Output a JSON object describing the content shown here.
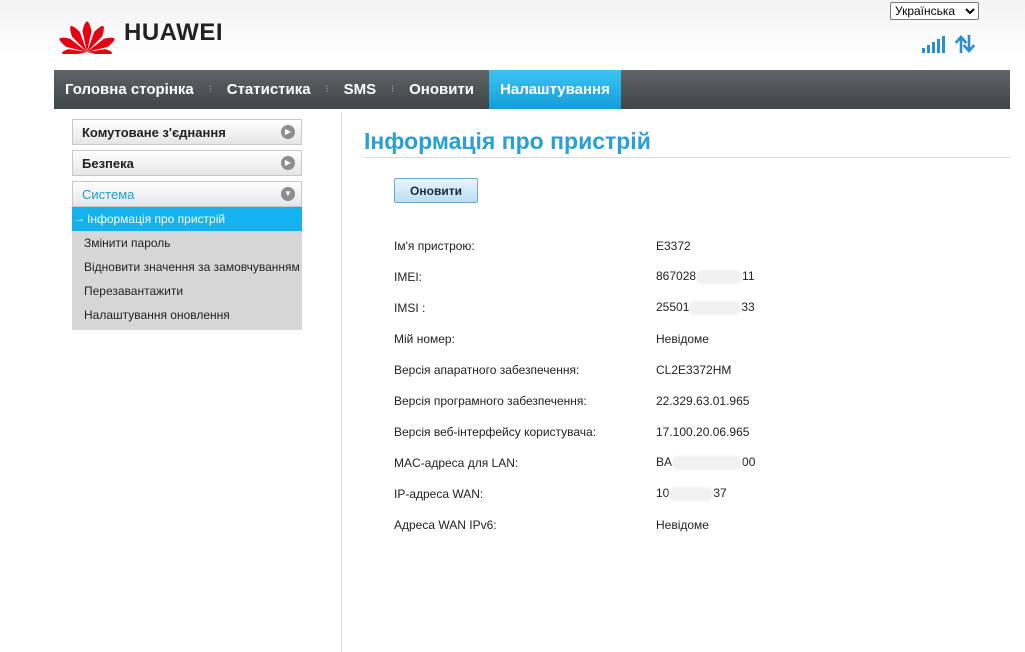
{
  "header": {
    "brand": "HUAWEI",
    "language": {
      "selected": "Українська",
      "options": [
        "Українська"
      ]
    },
    "colors": {
      "logo_red": "#e60012",
      "accent": "#2a9fd4",
      "nav_active": "#1fb0ea"
    }
  },
  "nav": {
    "items": [
      {
        "label": "Головна сторінка"
      },
      {
        "label": "Статистика"
      },
      {
        "label": "SMS"
      },
      {
        "label": "Оновити"
      },
      {
        "label": "Налаштування",
        "active": true
      }
    ]
  },
  "sidebar": {
    "sections": [
      {
        "label": "Комутоване з'єднання"
      },
      {
        "label": "Безпека"
      },
      {
        "label": "Система"
      }
    ],
    "system_items": [
      {
        "label": "Інформація про пристрій",
        "active": true
      },
      {
        "label": "Змінити пароль"
      },
      {
        "label": "Відновити значення за замовчуванням"
      },
      {
        "label": "Перезавантажити"
      },
      {
        "label": "Налаштування оновлення"
      }
    ]
  },
  "main": {
    "title": "Інформація про пристрій",
    "refresh_label": "Оновити",
    "rows": [
      {
        "label": "Ім'я пристрою:",
        "value": "E3372"
      },
      {
        "label": "IMEI:",
        "value_start": "867028",
        "value_end": "11"
      },
      {
        "label": "IMSI :",
        "value_start": "25501",
        "value_end": "33"
      },
      {
        "label": "Мій номер:",
        "value": "Невідоме"
      },
      {
        "label": "Версія апаратного забезпечення:",
        "value": "CL2E3372HM"
      },
      {
        "label": "Версія програмного забезпечення:",
        "value": "22.329.63.01.965"
      },
      {
        "label": "Версія веб-інтерфейсу користувача:",
        "value": "17.100.20.06.965"
      },
      {
        "label": "MAC-адреса для LAN:",
        "value_start": "BA",
        "value_end": "00"
      },
      {
        "label": "IP-адреса WAN:",
        "value_start": "10",
        "value_end": "37"
      },
      {
        "label": "Адреса WAN IPv6:",
        "value": "Невідоме"
      }
    ]
  },
  "icons": {
    "signal": "signal-strength-icon",
    "data": "data-transfer-icon",
    "expand": "chevron-right-icon",
    "collapse": "chevron-down-icon"
  }
}
